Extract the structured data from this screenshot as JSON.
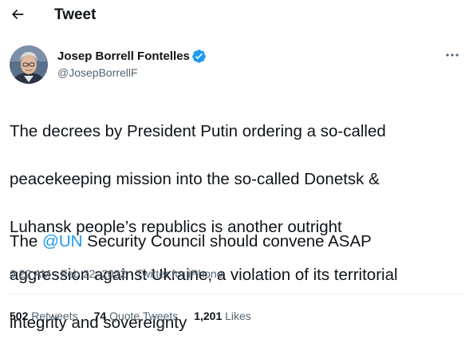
{
  "header": {
    "back_icon": "arrow-left-icon",
    "title": "Tweet"
  },
  "author": {
    "name": "Josep Borrell Fontelles",
    "handle": "@JosepBorrellF",
    "verified": true,
    "verified_color": "#1d9bf0"
  },
  "tweet": {
    "text_p1_line1": "The decrees by President Putin ordering a so-called",
    "text_p1_line2": "peacekeeping mission into the so-called Donetsk &",
    "text_p1_line3": "Luhansk people’s republics is another outright",
    "text_p1_line4": "aggression against Ukraine, a  violation of its territorial",
    "text_p1_line5": "integrity and sovereignty",
    "text_p2_before": "The ",
    "mention": "@UN",
    "text_p2_after": " Security Council should convene ASAP",
    "mention_color": "#1d9bf0"
  },
  "meta": {
    "time": "6:22 AM",
    "separator": " · ",
    "date": "Feb 22, 2022",
    "source": "Twitter for iPhone"
  },
  "stats": {
    "retweets_count": "502",
    "retweets_label": " Retweets",
    "quotes_count": "74",
    "quotes_label": " Quote Tweets",
    "likes_count": "1,201",
    "likes_label": " Likes"
  },
  "colors": {
    "text": "#0f1419",
    "secondary": "#536471",
    "accent": "#1d9bf0"
  }
}
